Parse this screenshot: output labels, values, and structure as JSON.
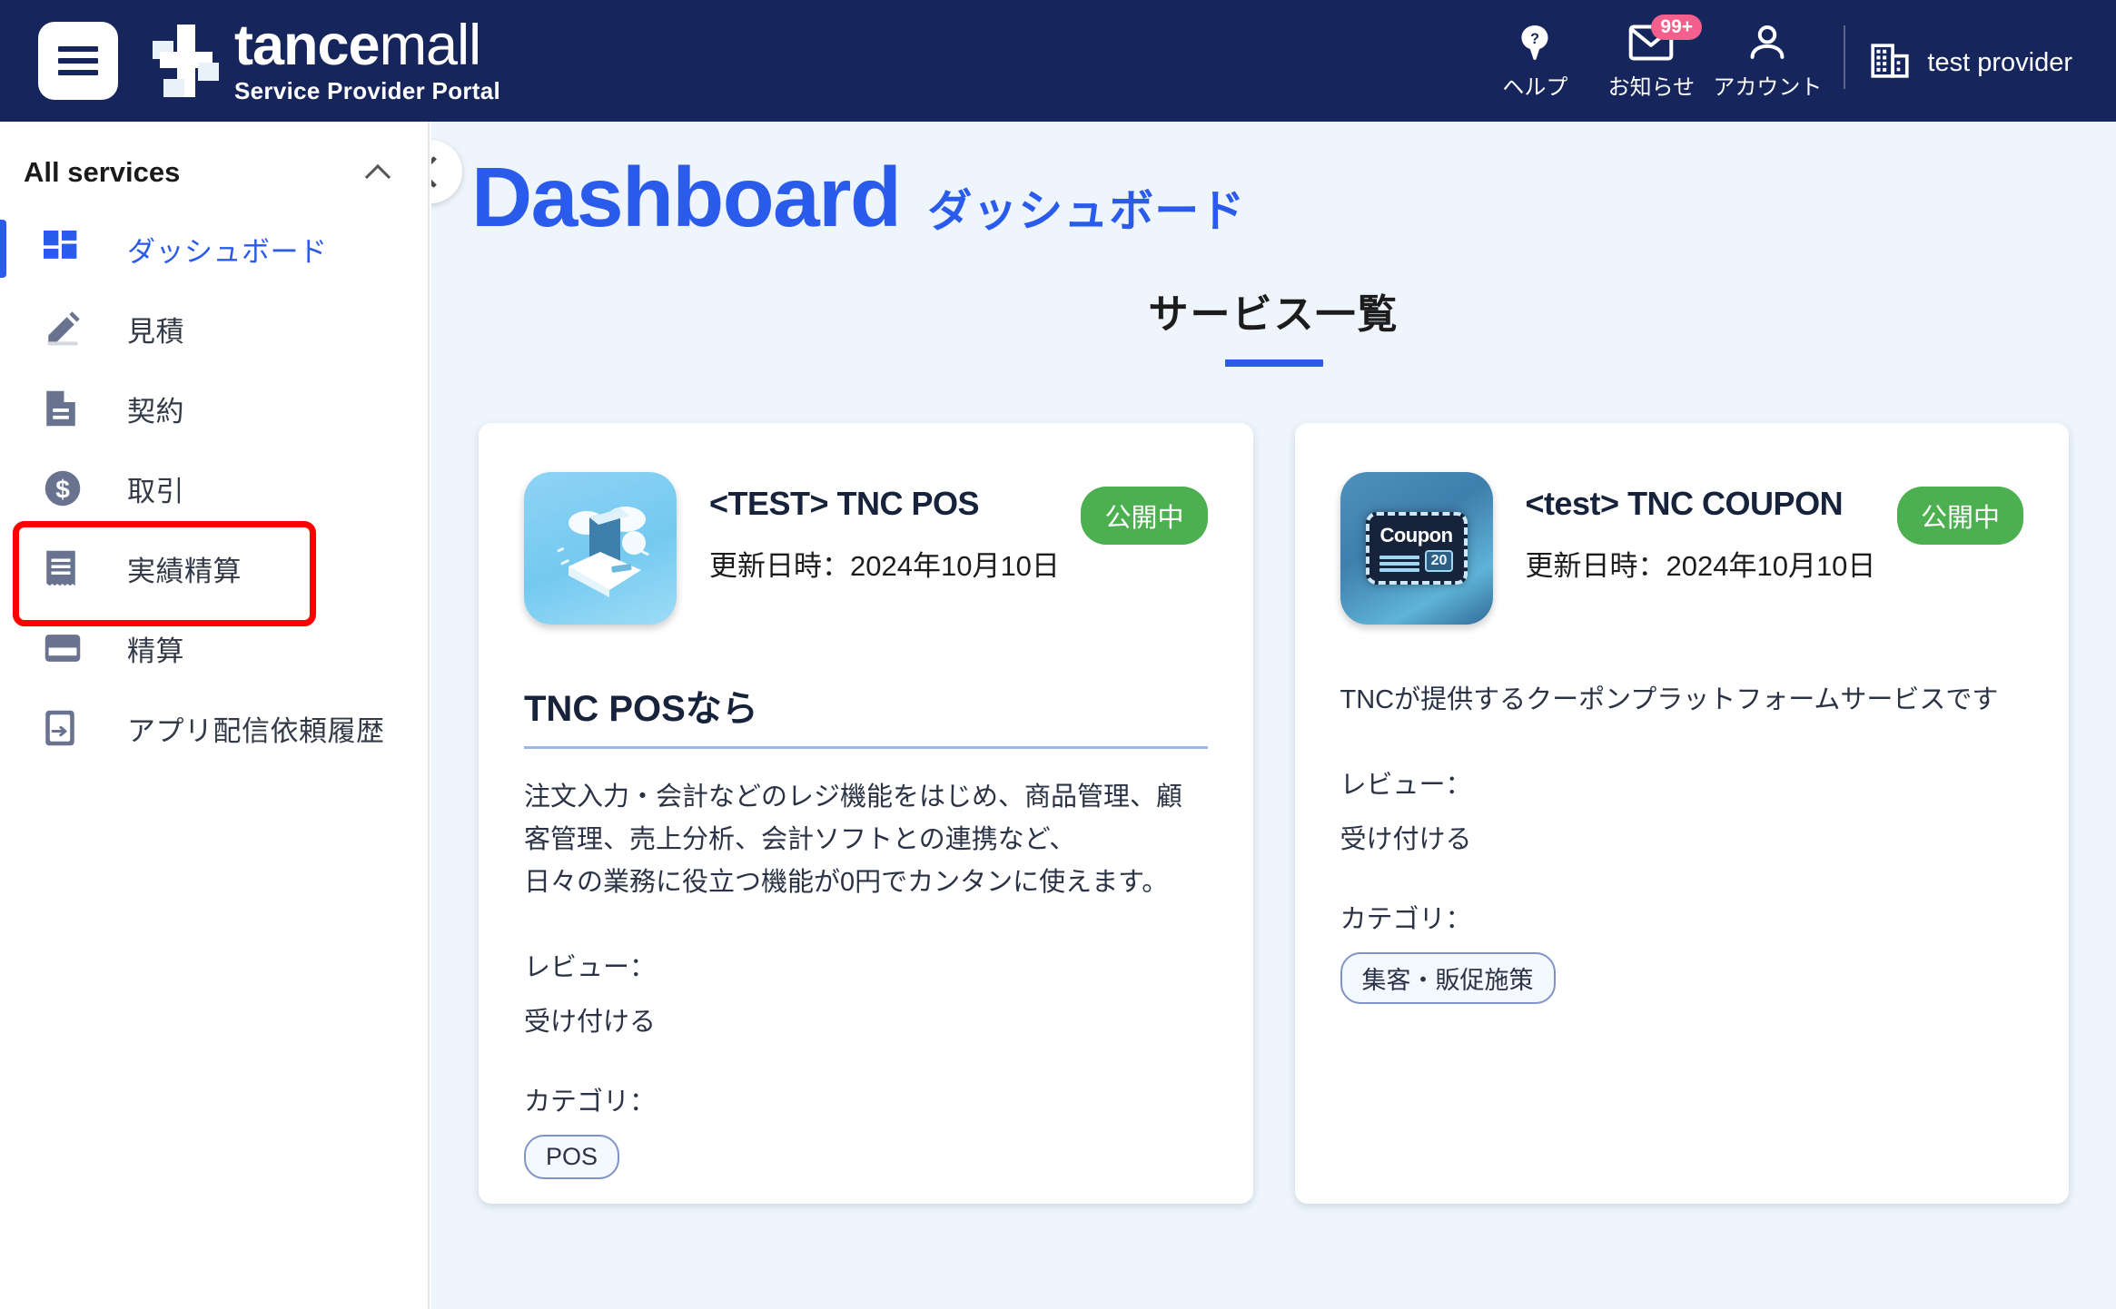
{
  "header": {
    "menu_icon": "hamburger-icon",
    "brand_name_bold": "tance",
    "brand_name_light": "mall",
    "brand_subtitle": "Service Provider Portal",
    "actions": [
      {
        "icon": "help-icon",
        "label": "ヘルプ",
        "badge": null
      },
      {
        "icon": "mail-icon",
        "label": "お知らせ",
        "badge": "99+"
      },
      {
        "icon": "person-icon",
        "label": "アカウント",
        "badge": null
      }
    ],
    "provider_icon": "building-icon",
    "provider_name": "test provider"
  },
  "sidebar": {
    "title": "All services",
    "collapse_icon": "chevron-up-icon",
    "items": [
      {
        "label": "ダッシュボード",
        "icon": "dashboard-grid-icon",
        "active": true,
        "highlighted": false
      },
      {
        "label": "見積",
        "icon": "pencil-icon",
        "active": false,
        "highlighted": false
      },
      {
        "label": "契約",
        "icon": "document-icon",
        "active": false,
        "highlighted": false
      },
      {
        "label": "取引",
        "icon": "dollar-coin-icon",
        "active": false,
        "highlighted": false
      },
      {
        "label": "実績精算",
        "icon": "receipt-icon",
        "active": false,
        "highlighted": true
      },
      {
        "label": "精算",
        "icon": "credit-card-icon",
        "active": false,
        "highlighted": false
      },
      {
        "label": "アプリ配信依頼履歴",
        "icon": "app-share-icon",
        "active": false,
        "highlighted": false
      }
    ]
  },
  "main": {
    "collapse_sidebar_icon": "chevron-left-icon",
    "page_title_en": "Dashboard",
    "page_title_ja": "ダッシュボード",
    "section_title": "サービス一覧",
    "cards": [
      {
        "icon": "pos-app-icon",
        "title": "<TEST> TNC POS",
        "updated": "更新日時：2024年10月10日",
        "status": "公開中",
        "lead": "TNC POSなら",
        "description": "注文入力・会計などのレジ機能をはじめ、商品管理、顧客管理、売上分析、会計ソフトとの連携など、\n日々の業務に役立つ機能が0円でカンタンに使えます。",
        "review_label": "レビュー：",
        "review_value": "受け付ける",
        "category_label": "カテゴリ：",
        "tags": [
          "POS"
        ]
      },
      {
        "icon": "coupon-app-icon",
        "title": "<test> TNC COUPON",
        "updated": "更新日時：2024年10月10日",
        "status": "公開中",
        "lead": null,
        "description": "TNCが提供するクーポンプラットフォームサービスです",
        "review_label": "レビュー：",
        "review_value": "受け付ける",
        "category_label": "カテゴリ：",
        "tags": [
          "集客・販促施策"
        ]
      }
    ]
  },
  "colors": {
    "header_bg": "#16255c",
    "accent_blue": "#2b5bea",
    "main_bg": "#eef5fc",
    "status_green": "#4caf50",
    "badge_pink": "#f45f8e",
    "highlight_red": "#ff0000"
  }
}
